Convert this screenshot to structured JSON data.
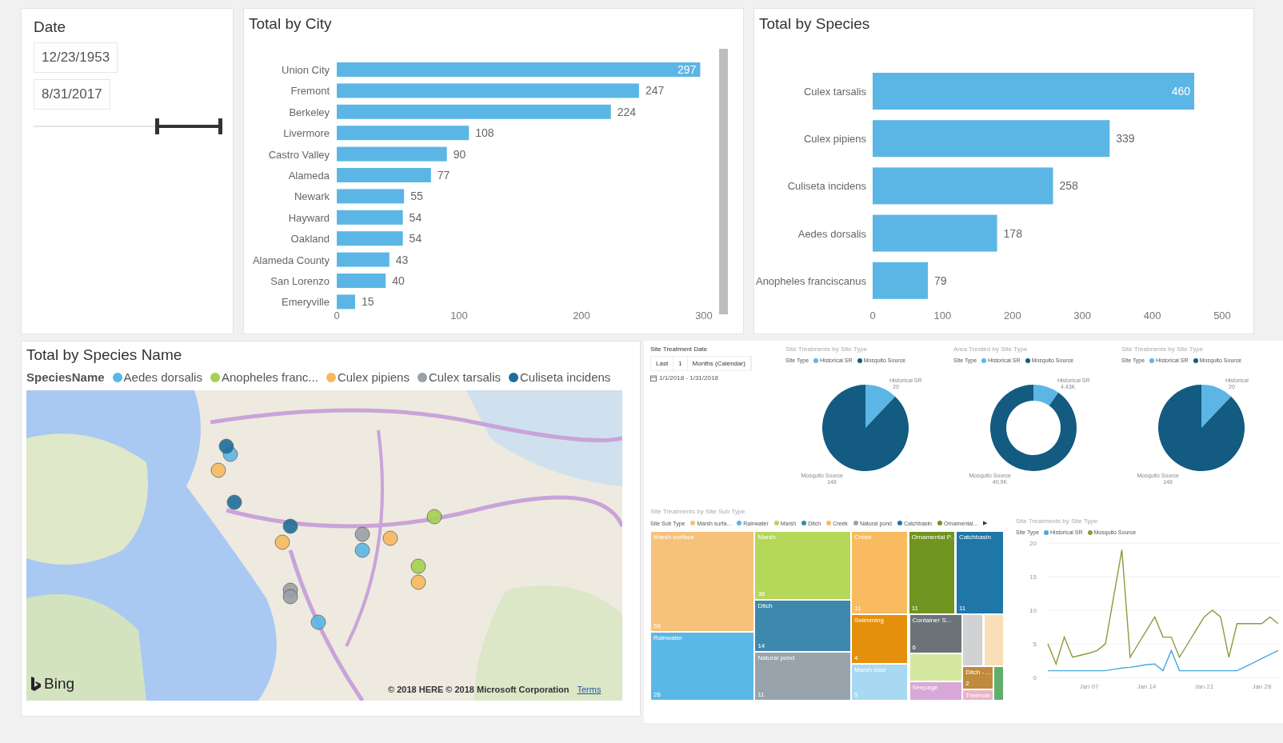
{
  "date_slicer": {
    "title": "Date",
    "start": "12/23/1953",
    "end": "8/31/2017",
    "slider": {
      "handles": [
        {
          "level": 0.66
        },
        {
          "level": 1
        }
      ]
    }
  },
  "city_chart": {
    "title": "Total by City",
    "chart_data": {
      "type": "bar",
      "orientation": "horizontal",
      "categories": [
        "Union City",
        "Fremont",
        "Berkeley",
        "Livermore",
        "Castro Valley",
        "Alameda",
        "Newark",
        "Hayward",
        "Oakland",
        "Alameda County",
        "San Lorenzo",
        "Emeryville"
      ],
      "values": [
        297,
        247,
        224,
        108,
        90,
        77,
        55,
        54,
        54,
        43,
        40,
        15
      ],
      "xlim": [
        0,
        300
      ],
      "xticks": [
        0,
        100,
        200,
        300
      ],
      "data_labels": true
    }
  },
  "species_chart": {
    "title": "Total by Species",
    "chart_data": {
      "type": "bar",
      "orientation": "horizontal",
      "categories": [
        "Culex tarsalis",
        "Culex pipiens",
        "Culiseta incidens",
        "Aedes dorsalis",
        "Anopheles franciscanus"
      ],
      "values": [
        460,
        339,
        258,
        178,
        79
      ],
      "xlim": [
        0,
        500
      ],
      "xticks": [
        0,
        100,
        200,
        300,
        400,
        500
      ],
      "data_labels": true
    }
  },
  "map": {
    "title": "Total by Species Name",
    "legend_title": "SpeciesName",
    "legend": [
      {
        "label": "Aedes dorsalis",
        "color": "#5bb6e6"
      },
      {
        "label": "Anopheles franc...",
        "color": "#a5d051"
      },
      {
        "label": "Culex pipiens",
        "color": "#f7b95e"
      },
      {
        "label": "Culex tarsalis",
        "color": "#9aa0a6"
      },
      {
        "label": "Culiseta incidens",
        "color": "#1e6e9c"
      }
    ],
    "logo": "Bing",
    "copyright": "© 2018 HERE  © 2018 Microsoft Corporation",
    "terms": "Terms"
  },
  "report": {
    "slicer": {
      "title": "Site Treatment Date",
      "mode": "Last",
      "count": "1",
      "unit": "Months (Calendar)",
      "range": "1/1/2018 - 1/31/2018"
    },
    "pies": [
      {
        "title": "Site Treatments by Site Type",
        "legend_title": "Site Type",
        "chart_data": {
          "type": "pie",
          "categories": [
            "Historical SR",
            "Mosquito Source"
          ],
          "values": [
            20,
            146
          ],
          "colors": [
            "#5bb6e6",
            "#135b80"
          ],
          "value_labels": [
            "20",
            "146"
          ]
        },
        "labels": [
          "Historical SR",
          "Mosquito Source"
        ]
      },
      {
        "title": "Area Treated by Site Type",
        "legend_title": "Site Type",
        "chart_data": {
          "type": "donut",
          "categories": [
            "Historical SR",
            "Mosquito Source"
          ],
          "values": [
            4.43,
            40.9
          ],
          "colors": [
            "#5bb6e6",
            "#135b80"
          ],
          "value_labels": [
            "4.43K",
            "40.9K"
          ]
        },
        "labels": [
          "Historical SR",
          "Mosquito Source"
        ]
      },
      {
        "title": "Site Treatments by Site Type",
        "legend_title": "Site Type",
        "chart_data": {
          "type": "pie",
          "categories": [
            "Historical SR",
            "Mosquito Source"
          ],
          "values": [
            20,
            146
          ],
          "colors": [
            "#5bb6e6",
            "#135b80"
          ],
          "value_labels": [
            "20",
            "146"
          ]
        },
        "labels": [
          "Historical",
          "Mosquito Source"
        ]
      }
    ],
    "treemap": {
      "title": "Site Treatments by Site Sub Type",
      "legend_title": "Site Sub Type",
      "legend": [
        {
          "label": "Marsh surfa...",
          "color": "#f6c27a"
        },
        {
          "label": "Rainwater",
          "color": "#5bb8e6"
        },
        {
          "label": "Marsh",
          "color": "#b5d75a"
        },
        {
          "label": "Ditch",
          "color": "#3e88ad"
        },
        {
          "label": "Creek",
          "color": "#f8bb60"
        },
        {
          "label": "Natural pond",
          "color": "#99a3ab"
        },
        {
          "label": "Catchbasin",
          "color": "#1f77a8"
        },
        {
          "label": "Ornamental...",
          "color": "#6f9420"
        }
      ],
      "more": "▶",
      "tiles": [
        {
          "name": "Marsh surface",
          "value": "58",
          "color": "#f6c27a"
        },
        {
          "name": "Rainwater",
          "value": "26",
          "color": "#5bb8e6"
        },
        {
          "name": "Marsh",
          "value": "38",
          "color": "#b5d75a"
        },
        {
          "name": "Ditch",
          "value": "14",
          "color": "#3e88ad"
        },
        {
          "name": "Natural pond",
          "value": "11",
          "color": "#99a3ab"
        },
        {
          "name": "Creek",
          "value": "11",
          "color": "#f8bb60"
        },
        {
          "name": "Swimming",
          "value": "4",
          "color": "#e5900c"
        },
        {
          "name": "Marsh tidal",
          "value": "5",
          "color": "#a9d9f2"
        },
        {
          "name": "Ornamental P...",
          "value": "11",
          "color": "#6f9420"
        },
        {
          "name": "Catchbasin",
          "value": "11",
          "color": "#1f77a8"
        },
        {
          "name": "Container S...",
          "value": "6",
          "color": "#6c7378"
        },
        {
          "color": "#d5e8a0"
        },
        {
          "name": "Seepage",
          "color": "#d8a8d8"
        },
        {
          "color": "#d0d2d4"
        },
        {
          "color": "#f9dfb8"
        },
        {
          "name": "Ditch - ...",
          "value": "2",
          "color": "#c08a3c"
        },
        {
          "name": "Treehole",
          "color": "#e9b4c8"
        },
        {
          "color": "#5fae6a"
        }
      ]
    },
    "line": {
      "title": "Site Treatments by Site Type",
      "legend_title": "Site Type",
      "chart_data": {
        "type": "line",
        "categories": [
          null,
          null,
          null,
          null,
          null,
          "Jan 07",
          null,
          null,
          null,
          null,
          null,
          null,
          "Jan 14",
          null,
          null,
          null,
          null,
          null,
          null,
          "Jan 21",
          null,
          null,
          null,
          null,
          null,
          null,
          "Jan 28",
          null,
          null
        ],
        "ylim": [
          0,
          20
        ],
        "yticks": [
          0,
          5,
          10,
          15,
          20
        ],
        "grid": true,
        "series": [
          {
            "name": "Historical SR",
            "color": "#4aa8dc",
            "values": [
              1,
              1,
              1,
              1,
              1,
              1,
              1,
              1,
              1.2,
              1.4,
              1.5,
              1.7,
              1.9,
              2,
              1,
              4,
              1,
              1,
              1,
              1,
              1,
              1,
              1,
              1,
              1.6,
              2.2,
              2.8,
              3.4,
              4
            ]
          },
          {
            "name": "Mosquito Source",
            "color": "#8c9a3c",
            "values": [
              5,
              2,
              6,
              3,
              3.3,
              3.6,
              4,
              5,
              12,
              19,
              3,
              5,
              7,
              9,
              6,
              6,
              3,
              5,
              7,
              9,
              10,
              9,
              3,
              8,
              8,
              8,
              8,
              9,
              8
            ]
          }
        ]
      }
    }
  }
}
